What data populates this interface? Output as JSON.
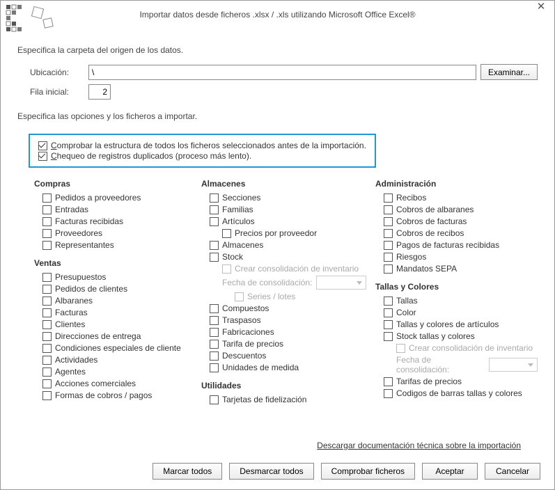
{
  "title": "Importar datos desde ficheros .xlsx / .xls utilizando Microsoft Office Excel®",
  "section1": "Especifica la carpeta del origen de los datos.",
  "path_label": "Ubicación:",
  "path_value": "\\",
  "row_label": "Fila inicial:",
  "row_value": "2",
  "browse_btn": "Examinar...",
  "section2": "Especifica las opciones y los ficheros a importar.",
  "opt1": "Comprobar la estructura de todos los ficheros seleccionados antes de la importación.",
  "opt2": "Chequeo de registros duplicados (proceso más lento).",
  "cats": {
    "compras": {
      "title": "Compras",
      "items": [
        "Pedidos a proveedores",
        "Entradas",
        "Facturas recibidas",
        "Proveedores",
        "Representantes"
      ]
    },
    "ventas": {
      "title": "Ventas",
      "items": [
        "Presupuestos",
        "Pedidos de clientes",
        "Albaranes",
        "Facturas",
        "Clientes",
        "Direcciones de entrega",
        "Condiciones especiales de cliente",
        "Actividades",
        "Agentes",
        "Acciones comerciales",
        "Formas de cobros / pagos"
      ]
    },
    "almacenes": {
      "title": "Almacenes",
      "items": [
        "Secciones",
        "Familias",
        "Artículos"
      ],
      "precios": "Precios por proveedor",
      "items2": [
        "Almacenes",
        "Stock"
      ],
      "crear": "Crear consolidación de inventario",
      "fecha": "Fecha de consolidación:",
      "series": "Series / lotes",
      "items3": [
        "Compuestos",
        "Traspasos",
        "Fabricaciones",
        "Tarifa de precios",
        "Descuentos",
        "Unidades de medida"
      ]
    },
    "utilidades": {
      "title": "Utilidades",
      "items": [
        "Tarjetas de fidelización"
      ]
    },
    "admin": {
      "title": "Administración",
      "items": [
        "Recibos",
        "Cobros de albaranes",
        "Cobros de facturas",
        "Cobros de recibos",
        "Pagos de facturas recibidas",
        "Riesgos",
        "Mandatos SEPA"
      ]
    },
    "tallas": {
      "title": "Tallas y Colores",
      "items": [
        "Tallas",
        "Color",
        "Tallas y colores de artículos",
        "Stock tallas y colores"
      ],
      "crear": "Crear consolidación de inventario",
      "fecha": "Fecha de consolidación:",
      "items2": [
        "Tarifas de precios",
        "Codigos de barras tallas y colores"
      ]
    }
  },
  "doc_link": "Descargar documentación técnica sobre la importación",
  "buttons": {
    "mark_all": "Marcar todos",
    "unmark_all": "Desmarcar todos",
    "check_files": "Comprobar ficheros",
    "accept": "Aceptar",
    "cancel": "Cancelar"
  }
}
